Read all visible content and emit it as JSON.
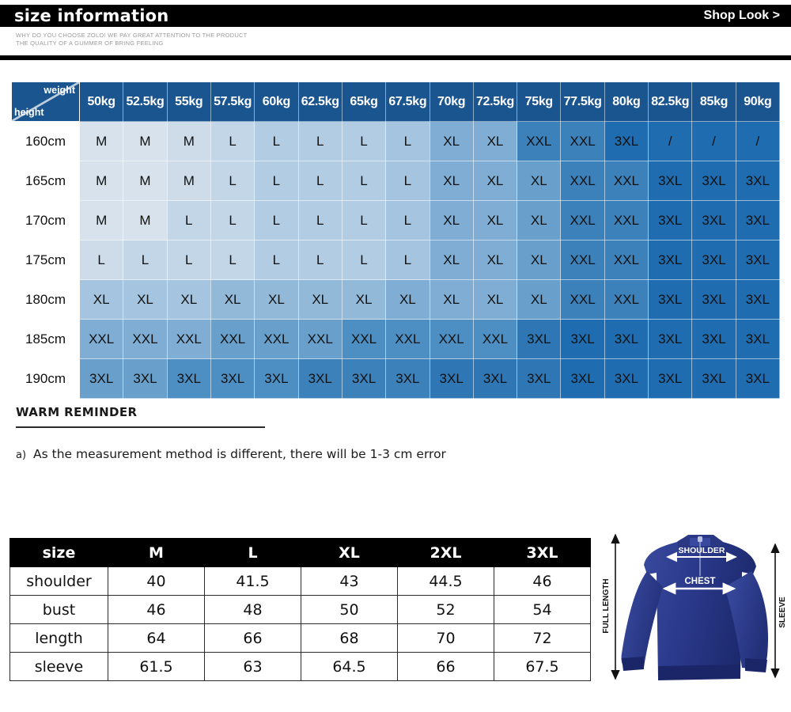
{
  "header": {
    "title": "size information",
    "shop_link": "Shop Look >",
    "subtitle_line1": "WHY DO YOU CHOOSE ZOLO! WE PAY GREAT ATTENTION TO THE PRODUCT",
    "subtitle_line2": "THE QUALITY OF A GUMMER OF BRING FEELING"
  },
  "size_grid": {
    "corner": {
      "weight_label": "weight",
      "height_label": "height"
    },
    "weights": [
      "50kg",
      "52.5kg",
      "55kg",
      "57.5kg",
      "60kg",
      "62.5kg",
      "65kg",
      "67.5kg",
      "70kg",
      "72.5kg",
      "75kg",
      "77.5kg",
      "80kg",
      "82.5kg",
      "85kg",
      "90kg"
    ],
    "heights": [
      "160cm",
      "165cm",
      "170cm",
      "175cm",
      "180cm",
      "185cm",
      "190cm"
    ],
    "rows": [
      [
        "M",
        "M",
        "M",
        "L",
        "L",
        "L",
        "L",
        "L",
        "XL",
        "XL",
        "XXL",
        "XXL",
        "3XL",
        "/",
        "/",
        "/"
      ],
      [
        "M",
        "M",
        "M",
        "L",
        "L",
        "L",
        "L",
        "L",
        "XL",
        "XL",
        "XL",
        "XXL",
        "XXL",
        "3XL",
        "3XL",
        "3XL"
      ],
      [
        "M",
        "M",
        "L",
        "L",
        "L",
        "L",
        "L",
        "L",
        "XL",
        "XL",
        "XL",
        "XXL",
        "XXL",
        "3XL",
        "3XL",
        "3XL"
      ],
      [
        "L",
        "L",
        "L",
        "L",
        "L",
        "L",
        "L",
        "L",
        "XL",
        "XL",
        "XL",
        "XXL",
        "XXL",
        "3XL",
        "3XL",
        "3XL"
      ],
      [
        "XL",
        "XL",
        "XL",
        "XL",
        "XL",
        "XL",
        "XL",
        "XL",
        "XL",
        "XL",
        "XL",
        "XXL",
        "XXL",
        "3XL",
        "3XL",
        "3XL"
      ],
      [
        "XXL",
        "XXL",
        "XXL",
        "XXL",
        "XXL",
        "XXL",
        "XXL",
        "XXL",
        "XXL",
        "XXL",
        "3XL",
        "3XL",
        "3XL",
        "3XL",
        "3XL",
        "3XL"
      ],
      [
        "3XL",
        "3XL",
        "3XL",
        "3XL",
        "3XL",
        "3XL",
        "3XL",
        "3XL",
        "3XL",
        "3XL",
        "3XL",
        "3XL",
        "3XL",
        "3XL",
        "3XL",
        "3XL"
      ]
    ]
  },
  "warm_reminder": {
    "title": "WARM REMINDER",
    "item_marker": "a)",
    "item_text": "As the measurement method is different, there will be 1-3 cm error"
  },
  "measurement_table": {
    "headers": [
      "size",
      "M",
      "L",
      "XL",
      "2XL",
      "3XL"
    ],
    "rows": [
      {
        "label": "shoulder",
        "values": [
          "40",
          "41.5",
          "43",
          "44.5",
          "46"
        ]
      },
      {
        "label": "bust",
        "values": [
          "46",
          "48",
          "50",
          "52",
          "54"
        ]
      },
      {
        "label": "length",
        "values": [
          "64",
          "66",
          "68",
          "70",
          "72"
        ]
      },
      {
        "label": "sleeve",
        "values": [
          "61.5",
          "63",
          "64.5",
          "66",
          "67.5"
        ]
      }
    ]
  },
  "garment": {
    "shoulder_label": "SHOULDER",
    "chest_label": "CHEST",
    "full_length_label": "FULL LENGTH",
    "sleeve_label": "SLEEVE",
    "color": "#2e3f8f"
  },
  "colors": {
    "header_blue": "#1b558f",
    "lightest_cell": "#d7e2ec",
    "darkest_cell": "#1f6cb0",
    "black": "#000000"
  }
}
